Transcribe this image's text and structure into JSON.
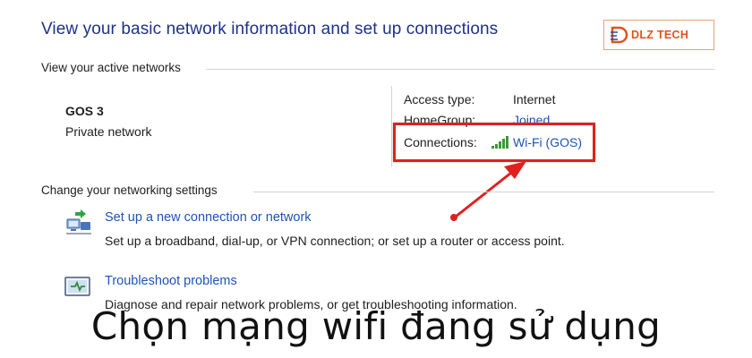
{
  "header": {
    "title": "View your basic network information and set up connections"
  },
  "brand": {
    "logo_text": "DLZ TECH",
    "logo_tagline": "",
    "logo_color": "#e0531d"
  },
  "active_networks": {
    "heading": "View your active networks",
    "network": {
      "name": "GOS  3",
      "category": "Private network"
    },
    "details": {
      "access_type_label": "Access type:",
      "access_type_value": "Internet",
      "homegroup_label": "HomeGroup:",
      "homegroup_value": "Joined",
      "connections_label": "Connections:",
      "connections_value": "Wi-Fi (GOS)",
      "connections_icon": "wifi-signal-icon"
    }
  },
  "networking_settings": {
    "heading": "Change your networking settings",
    "tasks": [
      {
        "link": "Set up a new connection or network",
        "description": "Set up a broadband, dial-up, or VPN connection; or set up a router or access point.",
        "icon": "network-setup-icon"
      },
      {
        "link": "Troubleshoot problems",
        "description": "Diagnose and repair network problems, or get troubleshooting information.",
        "icon": "troubleshoot-icon"
      }
    ]
  },
  "annotation": {
    "caption": "Chọn mạng wifi đang sử dụng",
    "highlight_color": "#e02020",
    "arrow_color": "#e02020"
  },
  "colors": {
    "title": "#1e3287",
    "link": "#1e54b4"
  }
}
